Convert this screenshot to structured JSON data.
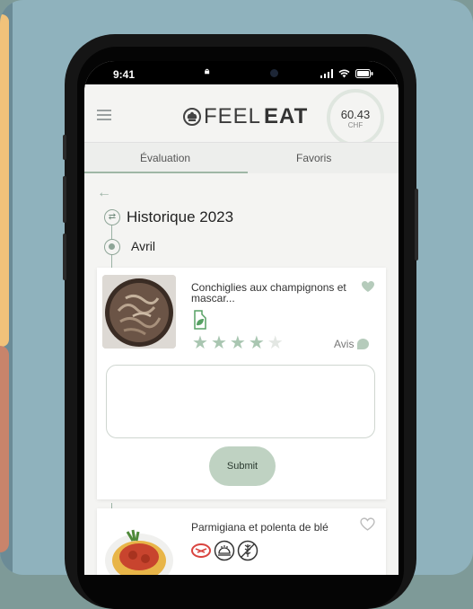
{
  "status": {
    "time": "9:41"
  },
  "app": {
    "logo_light": "FEEL",
    "logo_bold": "EAT",
    "balance_value": "60.43",
    "balance_currency": "CHF"
  },
  "tabs": [
    {
      "label": "Évaluation",
      "active": true
    },
    {
      "label": "Favoris",
      "active": false
    }
  ],
  "history": {
    "title": "Historique 2023",
    "month": "Avril"
  },
  "meal1": {
    "name": "Conchiglies aux champignons et mascar...",
    "rating": 4,
    "rating_max": 5,
    "review_label": "Avis",
    "comment_value": "",
    "submit_label": "Submit"
  },
  "meal2": {
    "name": "Parmigiana et polenta de blé"
  },
  "colors": {
    "accent": "#9fb7a6",
    "background": "#8fb2bd",
    "star_on": "#a9c6b1",
    "star_off": "#e3e7e3"
  }
}
